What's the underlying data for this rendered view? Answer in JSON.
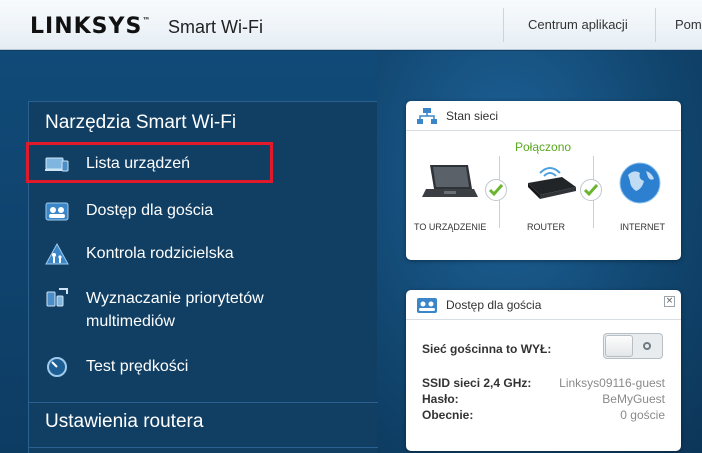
{
  "header": {
    "logo": "LINKSYS",
    "logo_tm": "™",
    "product": "Smart Wi-Fi",
    "nav": [
      "Centrum aplikacji",
      "Pomo"
    ]
  },
  "menu": {
    "tools_title": "Narzędzia Smart Wi-Fi",
    "items": [
      {
        "label": "Lista urządzeń",
        "icon": "device-list-icon"
      },
      {
        "label": "Dostęp dla gościa",
        "icon": "guest-access-icon"
      },
      {
        "label": "Kontrola rodzicielska",
        "icon": "parental-control-icon"
      },
      {
        "label": "Wyznaczanie priorytetów",
        "label2": "multimediów",
        "icon": "media-prioritization-icon"
      },
      {
        "label": "Test prędkości",
        "icon": "speed-test-icon"
      }
    ],
    "router_title": "Ustawienia routera",
    "highlighted_item": "Lista urządzeń",
    "highlight_color": "#e0192b"
  },
  "network_status": {
    "title": "Stan sieci",
    "status": "Połączono",
    "status_color": "#58a81f",
    "devices": [
      "TO URZĄDZENIE",
      "ROUTER",
      "INTERNET"
    ]
  },
  "guest_access": {
    "title": "Dostęp dla gościa",
    "toggle_label": "Sieć gościnna to WYŁ:",
    "toggle_state": "off",
    "rows": [
      {
        "key": "SSID sieci 2,4 GHz:",
        "value": "Linksys09116-guest"
      },
      {
        "key": "Hasło:",
        "value": "BeMyGuest"
      },
      {
        "key": "Obecnie:",
        "value": "0 goście"
      }
    ]
  }
}
